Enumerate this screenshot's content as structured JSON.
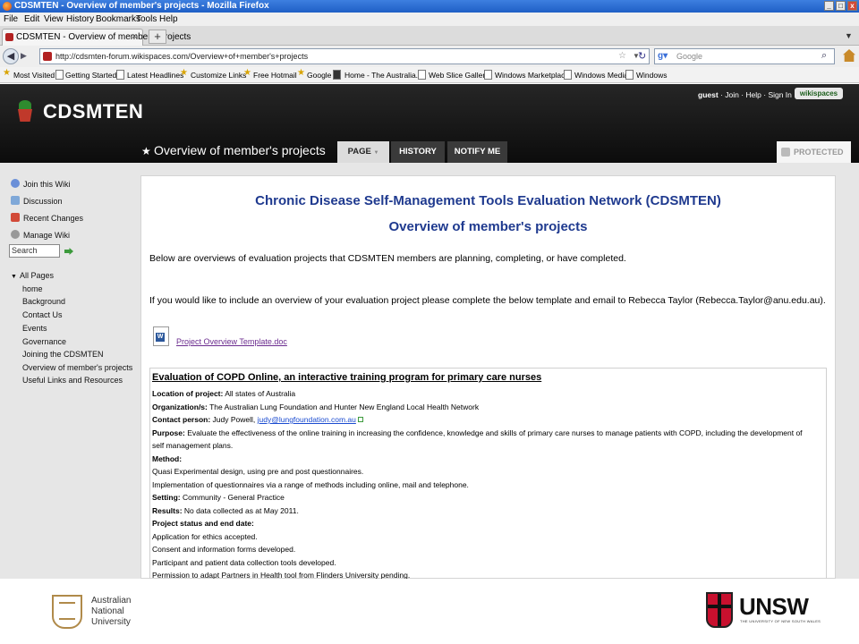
{
  "browser": {
    "window_title": "CDSMTEN - Overview of member's projects - Mozilla Firefox",
    "menu": [
      "File",
      "Edit",
      "View",
      "History",
      "Bookmarks",
      "Tools",
      "Help"
    ],
    "tab_label": "CDSMTEN - Overview of member's projects",
    "url": "http://cdsmten-forum.wikispaces.com/Overview+of+member's+projects",
    "search_placeholder": "Google",
    "bookmarks": [
      "Most Visited",
      "Getting Started",
      "Latest Headlines",
      "Customize Links",
      "Free Hotmail",
      "Google",
      "Home - The Australia...",
      "Web Slice Gallery",
      "Windows Marketplace",
      "Windows Media",
      "Windows"
    ]
  },
  "wiki": {
    "user_links": {
      "user": "guest",
      "join": "Join",
      "help": "Help",
      "sign_in": "Sign In"
    },
    "badge": "wikispaces",
    "name": "CDSMTEN",
    "page_heading": "Overview of member's projects",
    "tabs": [
      "PAGE",
      "HISTORY",
      "NOTIFY ME"
    ],
    "page_tab_arrow": "▼",
    "protected_label": "PROTECTED"
  },
  "sidebar": {
    "actions": [
      "Join this Wiki",
      "Discussion",
      "Recent Changes",
      "Manage Wiki"
    ],
    "search_placeholder": "Search",
    "all_pages_label": "All Pages",
    "pages": [
      "home",
      "Background",
      "Contact Us",
      "Events",
      "Governance",
      "Joining the CDSMTEN",
      "Overview of member's projects",
      "Useful Links and Resources"
    ]
  },
  "content": {
    "title1": "Chronic Disease Self-Management Tools Evaluation Network (CDSMTEN)",
    "title2": "Overview of member's projects",
    "intro": "Below are overviews of evaluation projects that CDSMTEN members are planning, completing, or have completed.",
    "instruction": "If you would like to include an overview of your evaluation project please complete the below template and email to Rebecca Taylor (Rebecca.Taylor@anu.edu.au).",
    "file_link": "Project Overview Template.doc",
    "project": {
      "title": "Evaluation of COPD Online, an interactive training program for primary care nurses",
      "location_label": "Location of project:",
      "location": "All states of Australia",
      "org_label": "Organization/s:",
      "org": "The Australian Lung Foundation and Hunter New England Local Health Network",
      "contact_label": "Contact person:",
      "contact_name": "Judy Powell,",
      "contact_email": "judy@lungfoundation.com.au",
      "purpose_label": "Purpose:",
      "purpose_line1": "Evaluate the effectiveness of the online training in increasing the confidence, knowledge and skills of primary care nurses to manage patients with COPD, including the development of",
      "purpose_line2": "self management plans.",
      "method_label": "Method:",
      "method_line1": "Quasi Experimental design, using pre and post questionnaires.",
      "method_line2": "Implementation of questionnaires via a range of methods including online, mail and telephone.",
      "setting_label": "Setting:",
      "setting": "Community - General Practice",
      "results_label": "Results:",
      "results": "No data collected as at May 2011.",
      "status_label": "Project status and end date:",
      "status_lines": [
        "Application for ethics accepted.",
        "Consent and information forms developed.",
        "Participant and patient data collection tools developed.",
        "Permission to adapt Partners in Health tool from Flinders University pending."
      ]
    }
  },
  "footer": {
    "anu_lines": [
      "Australian",
      "National",
      "University"
    ],
    "unsw_name": "UNSW",
    "unsw_tagline": "THE UNIVERSITY OF NEW SOUTH WALES"
  }
}
